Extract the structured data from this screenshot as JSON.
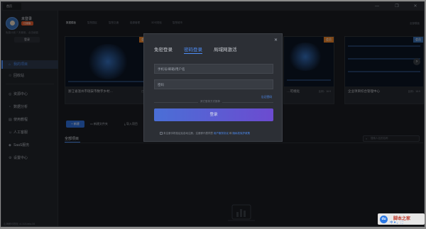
{
  "window": {
    "tab_title": "首页",
    "controls": [
      "—",
      "❐",
      "✕"
    ]
  },
  "sidebar": {
    "username": "未登录",
    "badge": "订阅版",
    "sub_text": "免费计划 7 天使用，点击续费",
    "login_label": "登录",
    "items": [
      {
        "icon": "house-icon",
        "glyph": "⌂",
        "label": "我的项目",
        "active": true
      },
      {
        "icon": "trash-icon",
        "glyph": "♲",
        "label": "回收站",
        "active": false
      },
      {
        "icon": "resource-icon",
        "glyph": "◎",
        "label": "资源中心",
        "active": false
      },
      {
        "icon": "data-icon",
        "glyph": "◔",
        "label": "数据分析",
        "active": false
      },
      {
        "icon": "tutorial-icon",
        "glyph": "▤",
        "label": "使用教程",
        "active": false
      },
      {
        "icon": "support-icon",
        "glyph": "☺",
        "label": "人工客服",
        "active": false
      },
      {
        "icon": "saas-icon",
        "glyph": "◆",
        "label": "SaaS服务",
        "active": false
      },
      {
        "icon": "settings-icon",
        "glyph": "⚙",
        "label": "设置中心",
        "active": false
      }
    ],
    "version": "山海鲸可视化 v1.5.8.beta.06"
  },
  "main": {
    "tabs": [
      "数据模板",
      "智慧园区",
      "智慧交通",
      "能源管理",
      "3D可视化",
      "智慧城市"
    ],
    "more_label": "全部模板",
    "cards": [
      {
        "caption": "浙江省温州市瑞安市数字乡村…",
        "meta": "已用",
        "corner": "会员"
      },
      {
        "caption": "…",
        "meta": "",
        "corner": ""
      },
      {
        "caption": "…可视化",
        "meta": "比例：16:9",
        "corner": "会员"
      },
      {
        "caption": "企业项目综合管理中心",
        "meta": "比例：16:9",
        "corner": "会员"
      }
    ],
    "toolbar": {
      "new_label": "新建",
      "new_folder_label": "新建文件夹",
      "import_label": "导入项目"
    },
    "project_tab": "全部项目",
    "search_placeholder": "搜索人名的名称"
  },
  "login_modal": {
    "tabs": [
      "免密登录",
      "密码登录",
      "局域网激活"
    ],
    "active_tab": 1,
    "phone_placeholder": "手机号/邮箱/用户名",
    "password_placeholder": "密码",
    "forgot_label": "忘记密码",
    "divider_label": "其它登录方式推荐",
    "login_button": "登录",
    "agree_prefix": "未注册手机验证后自动注册，注册即代表同意",
    "agree_link1": "用户服务协议",
    "agree_and": "和",
    "agree_link2": "隐私权保护政策"
  },
  "watermark": {
    "badge": "du",
    "line1": "脚本之家",
    "line2": "中 ♥ 。 ⛶"
  },
  "colors": {
    "accent": "#4e8ef7",
    "sidebar_bg": "#22252b",
    "main_bg": "#1b1d22",
    "modal_bg": "#2c2f35",
    "orange_badge": "#e8812b"
  }
}
